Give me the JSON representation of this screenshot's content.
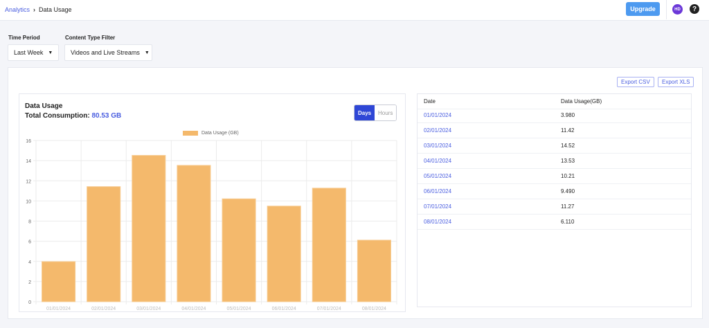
{
  "header": {
    "breadcrumb_root": "Analytics",
    "breadcrumb_current": "Data Usage",
    "upgrade_label": "Upgrade",
    "avatar_initials": "HD",
    "help_icon": "?"
  },
  "filters": {
    "time_period_label": "Time Period",
    "time_period_value": "Last Week",
    "content_type_label": "Content Type Filter",
    "content_type_value": "Videos and Live Streams"
  },
  "export": {
    "csv_label": "Export CSV",
    "xls_label": "Export XLS"
  },
  "chart_card": {
    "title": "Data Usage",
    "total_label": "Total Consumption:",
    "total_value": "80.53 GB",
    "toggle": {
      "days": "Days",
      "hours": "Hours"
    }
  },
  "chart_data": {
    "type": "bar",
    "title": "",
    "legend": [
      "Data Usage (GB)"
    ],
    "legend_position": "top",
    "categories": [
      "01/01/2024",
      "02/01/2024",
      "03/01/2024",
      "04/01/2024",
      "05/01/2024",
      "06/01/2024",
      "07/01/2024",
      "08/01/2024"
    ],
    "values": [
      3.98,
      11.42,
      14.52,
      13.53,
      10.21,
      9.49,
      11.27,
      6.11
    ],
    "ylim": [
      0,
      16
    ],
    "yticks": [
      0,
      2,
      4,
      6,
      8,
      10,
      12,
      14,
      16
    ],
    "grid": true,
    "color": "#f4b96c"
  },
  "table": {
    "headers": [
      "Date",
      "Data Usage(GB)"
    ],
    "rows": [
      [
        "01/01/2024",
        "3.980"
      ],
      [
        "02/01/2024",
        "11.42"
      ],
      [
        "03/01/2024",
        "14.52"
      ],
      [
        "04/01/2024",
        "13.53"
      ],
      [
        "05/01/2024",
        "10.21"
      ],
      [
        "06/01/2024",
        "9.490"
      ],
      [
        "07/01/2024",
        "11.27"
      ],
      [
        "08/01/2024",
        "6.110"
      ]
    ]
  }
}
